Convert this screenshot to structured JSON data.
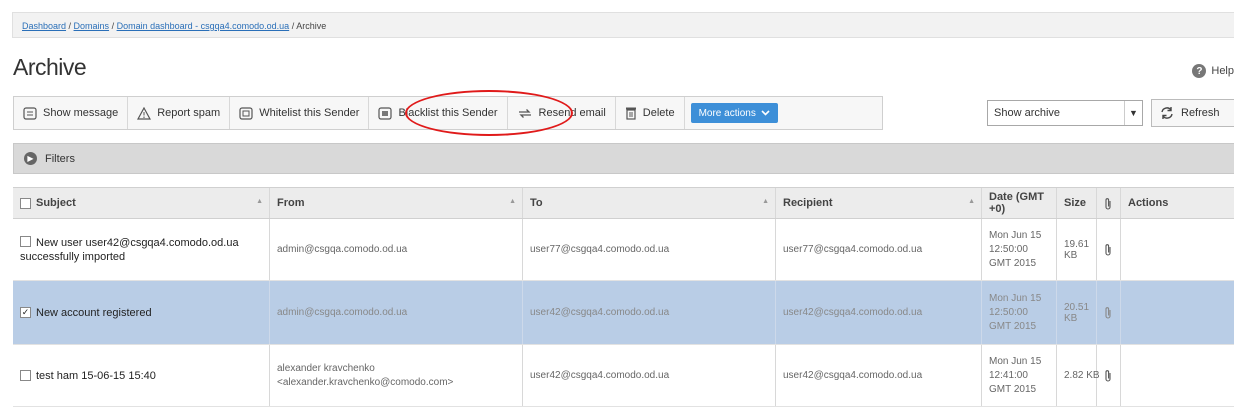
{
  "breadcrumb": {
    "items": [
      "Dashboard",
      "Domains",
      "Domain dashboard - csgqa4.comodo.od.ua"
    ],
    "separator": " / ",
    "current": "Archive"
  },
  "page_title": "Archive",
  "help_label": "Help",
  "toolbar": {
    "show_message": "Show message",
    "report_spam": "Report spam",
    "whitelist": "Whitelist this Sender",
    "blacklist": "Blacklist this Sender",
    "resend": "Resend email",
    "delete": "Delete",
    "more_actions": "More actions"
  },
  "archive_select": {
    "value": "Show archive"
  },
  "refresh_label": "Refresh",
  "filters_label": "Filters",
  "table": {
    "headers": {
      "subject": "Subject",
      "from": "From",
      "to": "To",
      "recipient": "Recipient",
      "date": "Date (GMT +0)",
      "size": "Size",
      "actions": "Actions"
    },
    "rows": [
      {
        "checked": false,
        "subject": "New user user42@csgqa4.comodo.od.ua successfully imported",
        "from": "admin@csgqa.comodo.od.ua",
        "to": "user77@csgqa4.comodo.od.ua",
        "recipient": "user77@csgqa4.comodo.od.ua",
        "date": "Mon Jun 15 12:50:00 GMT 2015",
        "size": "19.61 KB"
      },
      {
        "checked": true,
        "subject": "New account registered",
        "from": "admin@csgqa.comodo.od.ua",
        "to": "user42@csgqa4.comodo.od.ua",
        "recipient": "user42@csgqa4.comodo.od.ua",
        "date": "Mon Jun 15 12:50:00 GMT 2015",
        "size": "20.51 KB"
      },
      {
        "checked": false,
        "subject": "test ham 15-06-15 15:40",
        "from": "alexander kravchenko <alexander.kravchenko@comodo.com>",
        "to": "user42@csgqa4.comodo.od.ua",
        "recipient": "user42@csgqa4.comodo.od.ua",
        "date": "Mon Jun 15 12:41:00 GMT 2015",
        "size": "2.82 KB"
      }
    ]
  },
  "colors": {
    "link": "#2a6fb8",
    "selected_row": "#b9cde6",
    "primary_button": "#3d8fd8",
    "highlight_ellipse": "#e01a1a"
  }
}
